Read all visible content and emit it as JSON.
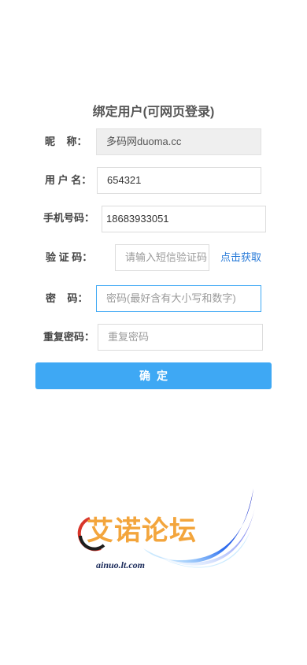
{
  "page": {
    "title": "绑定用户(可网页登录)"
  },
  "form": {
    "nickname": {
      "label": "昵    称：",
      "value": "多码网duoma.cc"
    },
    "username": {
      "label": "用 户 名：",
      "value": "654321"
    },
    "phone": {
      "label": "手机号码：",
      "value": "18683933051"
    },
    "code": {
      "label": "验 证 码：",
      "placeholder": "请输入短信验证码",
      "get_code_label": "点击获取"
    },
    "password": {
      "label": "密    码：",
      "placeholder": "密码(最好含有大小写和数字)"
    },
    "confirm_password": {
      "label": "重复密码：",
      "placeholder": "重复密码"
    },
    "submit_label": "确定"
  },
  "logo": {
    "name": "艾诺论坛",
    "domain": "ainuo.lt.com",
    "colors": {
      "text": "#f3a53c",
      "swoosh": "#2a3fd8",
      "circle": "#d8352a"
    }
  }
}
